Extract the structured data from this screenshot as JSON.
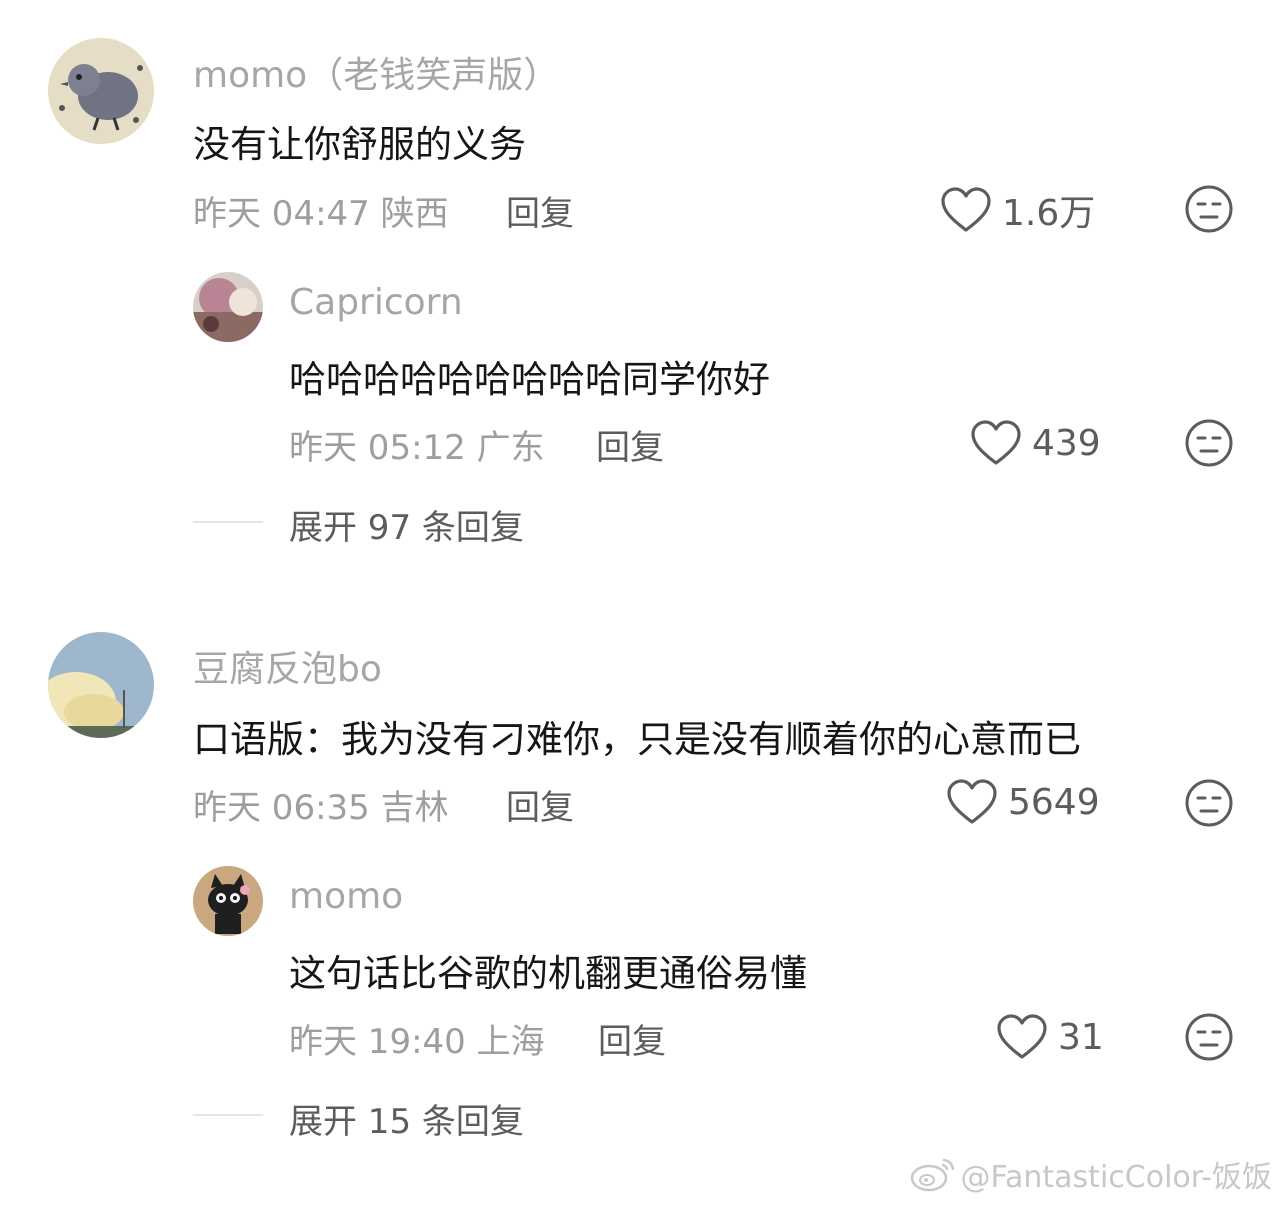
{
  "comments": [
    {
      "author": "momo（老钱笑声版）",
      "text": "没有让你舒服的义务",
      "meta": "昨天 04:47 陕西",
      "reply_label": "回复",
      "likes": "1.6万",
      "avatar_icon": "bird-avatar",
      "reply": {
        "author": "Capricorn",
        "text": "哈哈哈哈哈哈哈哈哈同学你好",
        "meta": "昨天 05:12 广东",
        "reply_label": "回复",
        "likes": "439",
        "avatar_icon": "girl-avatar"
      },
      "expand_label": "展开 97 条回复"
    },
    {
      "author": "豆腐反泡bo",
      "text": "口语版：我为没有刁难你，只是没有顺着你的心意而已",
      "meta": "昨天 06:35 吉林",
      "reply_label": "回复",
      "likes": "5649",
      "avatar_icon": "sky-avatar",
      "reply": {
        "author": "momo",
        "text": "这句话比谷歌的机翻更通俗易懂",
        "meta": "昨天 19:40 上海",
        "reply_label": "回复",
        "likes": "31",
        "avatar_icon": "cat-avatar"
      },
      "expand_label": "展开 15 条回复"
    }
  ],
  "watermark": "@FantasticColor-饭饭",
  "colors": {
    "author": "#a6a6a6",
    "text": "#161616",
    "meta": "#9e9e9e",
    "action": "#5c5c5c"
  }
}
